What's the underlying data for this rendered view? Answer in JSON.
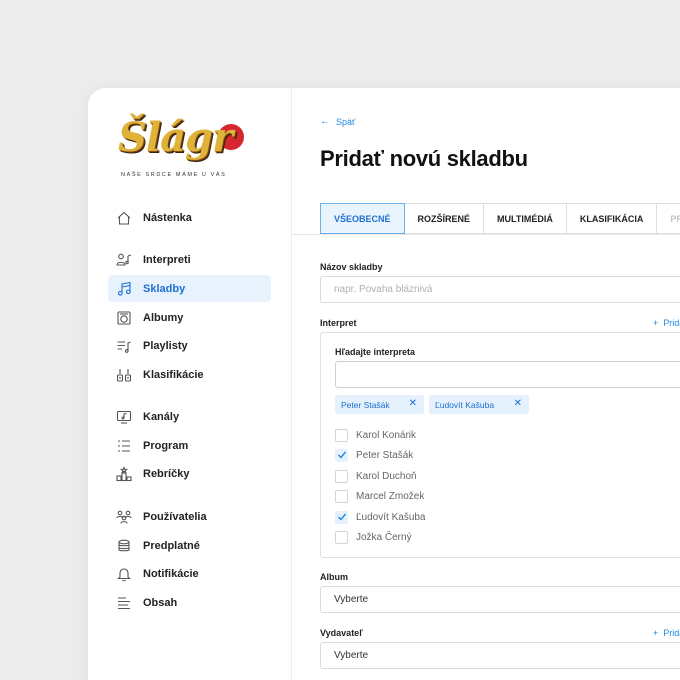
{
  "brand": {
    "logo_text": "Šlágr",
    "tagline": "NAŠE SRDCE MÁME U VÁS"
  },
  "sidebar": {
    "items": [
      {
        "label": "Nástenka",
        "icon": "home-icon"
      },
      {
        "label": "Interpreti",
        "icon": "people-music-icon"
      },
      {
        "label": "Skladby",
        "icon": "music-note-icon",
        "active": true
      },
      {
        "label": "Albumy",
        "icon": "album-icon"
      },
      {
        "label": "Playlisty",
        "icon": "playlist-icon"
      },
      {
        "label": "Klasifikácie",
        "icon": "classification-icon"
      },
      {
        "label": "Kanály",
        "icon": "channel-icon"
      },
      {
        "label": "Program",
        "icon": "program-list-icon"
      },
      {
        "label": "Rebríčky",
        "icon": "chart-ranking-icon"
      },
      {
        "label": "Používatelia",
        "icon": "users-icon"
      },
      {
        "label": "Predplatné",
        "icon": "coins-icon"
      },
      {
        "label": "Notifikácie",
        "icon": "bell-icon"
      },
      {
        "label": "Obsah",
        "icon": "content-lines-icon"
      }
    ]
  },
  "main": {
    "back_label": "Späť",
    "title": "Pridať novú skladbu",
    "tabs": [
      {
        "label": "VŠEOBECNÉ",
        "state": "active"
      },
      {
        "label": "ROZŠÍRENÉ",
        "state": "normal"
      },
      {
        "label": "MULTIMÉDIÁ",
        "state": "normal"
      },
      {
        "label": "KLASIFIKÁCIA",
        "state": "normal"
      },
      {
        "label": "PREKLADY",
        "state": "disabled"
      }
    ],
    "song_name": {
      "label": "Názov skladby",
      "placeholder": "napr. Povaha bláznivá"
    },
    "interpret": {
      "label": "Interpret",
      "add_label": "Pridať",
      "search_label": "Hľadajte interpreta",
      "search_value": "",
      "chips": [
        "Peter Stašák",
        "Ľudovít Kašuba"
      ],
      "options": [
        {
          "label": "Karol Konárik",
          "checked": false
        },
        {
          "label": "Peter Stašák",
          "checked": true
        },
        {
          "label": "Karol Duchoň",
          "checked": false
        },
        {
          "label": "Marcel Zmožek",
          "checked": false
        },
        {
          "label": "Ľudovít Kašuba",
          "checked": true
        },
        {
          "label": "Jožka Černý",
          "checked": false
        }
      ]
    },
    "album": {
      "label": "Album",
      "value": "Vyberte"
    },
    "publisher": {
      "label": "Vydavateľ",
      "add_label": "Pridať",
      "value": "Vyberte"
    }
  },
  "colors": {
    "accent": "#1e88e5",
    "active_bg": "#e8f2fd",
    "background": "#ececec"
  }
}
